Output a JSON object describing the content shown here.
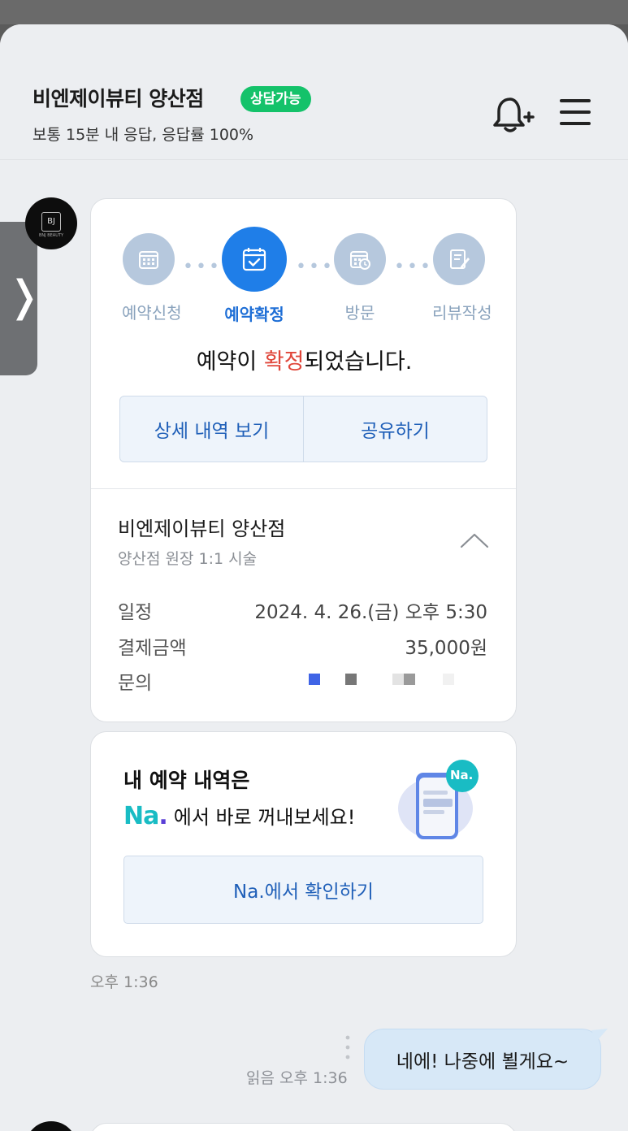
{
  "header": {
    "store_name": "비엔제이뷰티 양산점",
    "badge": "상담가능",
    "response_info": "보통 15분 내 응답, 응답률 100%"
  },
  "avatar": {
    "monogram": "BJ",
    "subtext": "BNJ BEAUTY"
  },
  "reservation": {
    "steps": [
      {
        "label": "예약신청",
        "icon": "calendar-icon",
        "active": false
      },
      {
        "label": "예약확정",
        "icon": "calendar-check-icon",
        "active": true
      },
      {
        "label": "방문",
        "icon": "calendar-clock-icon",
        "active": false
      },
      {
        "label": "리뷰작성",
        "icon": "edit-note-icon",
        "active": false
      }
    ],
    "message_prefix": "예약이 ",
    "message_highlight": "확정",
    "message_suffix": "되었습니다.",
    "detail_button": "상세 내역 보기",
    "share_button": "공유하기",
    "shop": "비엔제이뷰티 양산점",
    "service": "양산점 원장 1:1 시술",
    "rows": [
      {
        "key": "일정",
        "value": "2024. 4. 26.(금) 오후 5:30"
      },
      {
        "key": "결제금액",
        "value": "35,000원"
      },
      {
        "key": "문의",
        "value": ""
      }
    ]
  },
  "na_card": {
    "title": "내 예약 내역은",
    "logo": "Na",
    "logo_dot": ".",
    "line": "에서 바로 꺼내보세요!",
    "badge": "Na.",
    "button": "Na.에서 확인하기"
  },
  "messages": {
    "card_time": "오후 1:36",
    "reply_meta": "읽음 오후 1:36",
    "reply_text": "네에! 나중에 뵐게요~"
  },
  "colors": {
    "accent_blue": "#1f7ee8",
    "badge_green": "#14c26a",
    "highlight_red": "#e0463a",
    "na_teal": "#19bcc4"
  }
}
